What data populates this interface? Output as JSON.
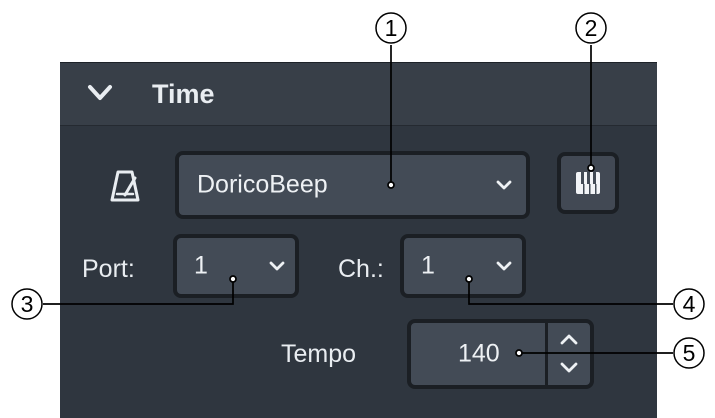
{
  "panel": {
    "title": "Time",
    "collapse_icon": "chevron-down-icon"
  },
  "metronome": {
    "icon": "metronome-icon"
  },
  "device": {
    "selected": "DoricoBeep",
    "dropdown_icon": "chevron-down-icon"
  },
  "piano_button": {
    "icon": "piano-keyboard-icon"
  },
  "port": {
    "label": "Port:",
    "value": "1"
  },
  "channel": {
    "label": "Ch.:",
    "value": "1"
  },
  "tempo": {
    "label": "Tempo",
    "value": "140",
    "up_icon": "chevron-up-icon",
    "down_icon": "chevron-down-icon"
  },
  "callouts": [
    {
      "number": "1"
    },
    {
      "number": "2"
    },
    {
      "number": "3"
    },
    {
      "number": "4"
    },
    {
      "number": "5"
    }
  ],
  "colors": {
    "page_background": "#ffffff",
    "panel_background": "#2f363f",
    "header_background": "#383f48",
    "control_background": "#434b56",
    "control_border": "#1b1f24",
    "text": "#eef1f4",
    "callout_line": "#000000"
  }
}
